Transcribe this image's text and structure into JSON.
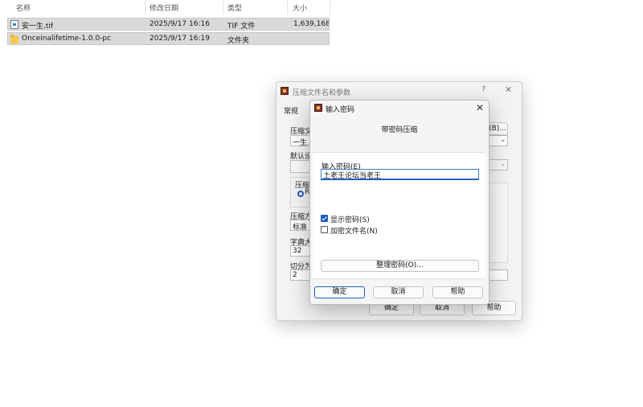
{
  "explorer": {
    "columns": {
      "name": "名称",
      "date": "修改日期",
      "type": "类型",
      "size": "大小"
    },
    "sort_indicator": "^",
    "files": [
      {
        "name": "安一生.tif",
        "date": "2025/9/17 16:16",
        "type": "TIF 文件",
        "size": "1,639,168...",
        "icon": "image-file-icon"
      },
      {
        "name": "Onceinalifetime-1.0.0-pc",
        "date": "2025/9/17 16:19",
        "type": "文件夹",
        "size": "",
        "icon": "folder-icon"
      }
    ]
  },
  "bg_dialog": {
    "title": "压缩文件名和参数",
    "help_glyph": "?",
    "close_glyph": "✕",
    "tab_general": "常规",
    "archive_name_label": "压缩文",
    "archive_name_value": "一生.10",
    "browse_label": "(B)...",
    "default_label": "默认设",
    "format_label": "压缩文",
    "format_radio_char": "R",
    "method_label": "压缩方",
    "method_value": "标准",
    "dict_label": "字典大",
    "dict_value": "32",
    "split_label": "切分为",
    "split_value": "2",
    "ok": "确定",
    "cancel": "取消",
    "help": "帮助"
  },
  "pw_dialog": {
    "title": "输入密码",
    "close_glyph": "✕",
    "subtitle": "带密码压缩",
    "password_label": "输入密码(E)",
    "password_value": "上老王论坛当老王",
    "show_password_label": "显示密码(S)",
    "show_password_checked": true,
    "encrypt_names_label": "加密文件名(N)",
    "encrypt_names_checked": false,
    "manage_button": "整理密码(O)...",
    "ok": "确定",
    "cancel": "取消",
    "help": "帮助"
  }
}
